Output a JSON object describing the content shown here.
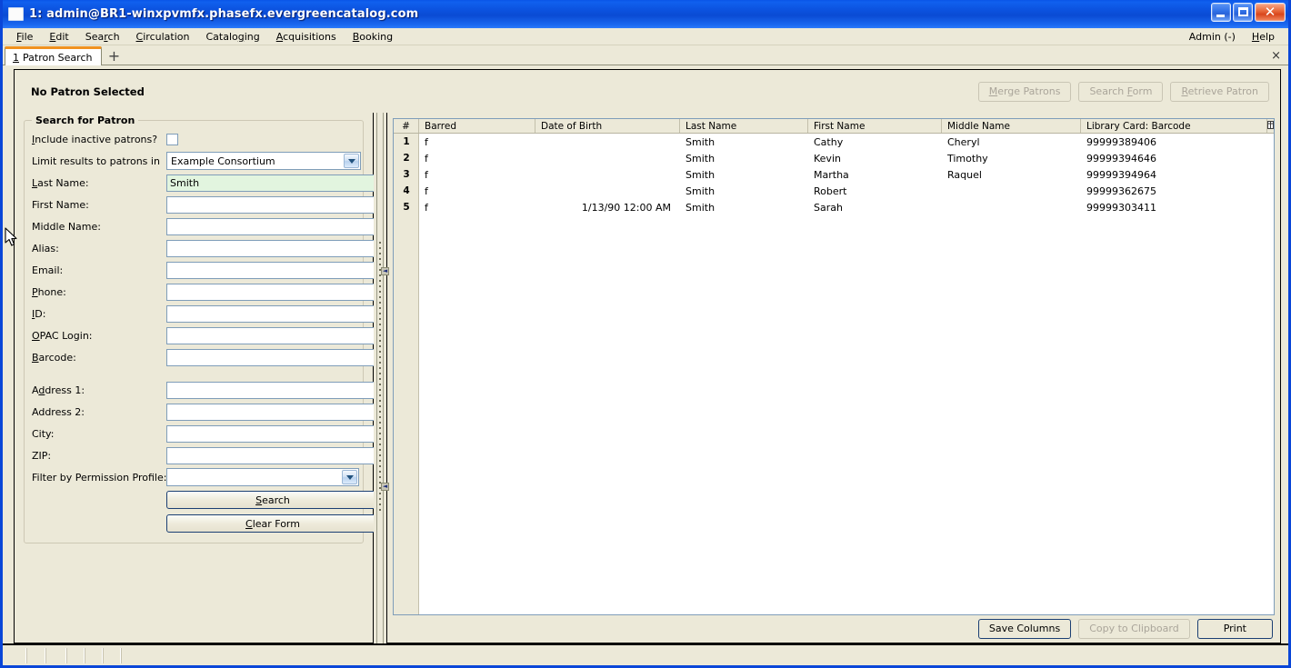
{
  "window": {
    "title": "1: admin@BR1-winxpvmfx.phasefx.evergreencatalog.com",
    "minimize_label": "",
    "maximize_label": "",
    "close_label": "✕"
  },
  "menubar": {
    "items": [
      {
        "label": "File",
        "accel": "F"
      },
      {
        "label": "Edit",
        "accel": "E"
      },
      {
        "label": "Search",
        "accel": "r"
      },
      {
        "label": "Circulation",
        "accel": "C"
      },
      {
        "label": "Cataloging",
        "accel": "g"
      },
      {
        "label": "Acquisitions",
        "accel": "A"
      },
      {
        "label": "Booking",
        "accel": "B"
      }
    ],
    "right_items": [
      {
        "label": "Admin (-)",
        "accel": ""
      },
      {
        "label": "Help",
        "accel": "H"
      }
    ]
  },
  "tabs": {
    "active": {
      "number": "1",
      "label": "Patron Search"
    },
    "new_tab_label": "+",
    "close_all_label": "×"
  },
  "banner": {
    "title": "No Patron Selected",
    "buttons": [
      {
        "label": "Merge Patrons",
        "enabled": false
      },
      {
        "label": "Search Form",
        "enabled": false
      },
      {
        "label": "Retrieve Patron",
        "enabled": false
      }
    ]
  },
  "search_form": {
    "legend": "Search for Patron",
    "include_inactive_label": "Include inactive patrons?",
    "include_inactive_checked": false,
    "limit_results_label": "Limit results to patrons in",
    "limit_results_value": "Example Consortium",
    "fields": [
      {
        "label": "Last Name:",
        "value": "Smith",
        "placeholder": "",
        "focused": true
      },
      {
        "label": "First Name:",
        "value": "",
        "placeholder": "",
        "focused": false
      },
      {
        "label": "Middle Name:",
        "value": "",
        "placeholder": "",
        "focused": false
      },
      {
        "label": "Alias:",
        "value": "",
        "placeholder": "",
        "focused": false
      },
      {
        "label": "Email:",
        "value": "",
        "placeholder": "",
        "focused": false
      },
      {
        "label": "Phone:",
        "value": "",
        "placeholder": "",
        "focused": false
      },
      {
        "label": "ID:",
        "value": "",
        "placeholder": "",
        "focused": false
      },
      {
        "label": "OPAC Login:",
        "value": "",
        "placeholder": "",
        "focused": false
      },
      {
        "label": "Barcode:",
        "value": "",
        "placeholder": "",
        "focused": false
      }
    ],
    "address_fields": [
      {
        "label": "Address 1:",
        "value": "",
        "placeholder": ""
      },
      {
        "label": "Address 2:",
        "value": "",
        "placeholder": ""
      },
      {
        "label": "City:",
        "value": "",
        "placeholder": ""
      },
      {
        "label": "ZIP:",
        "value": "",
        "placeholder": ""
      }
    ],
    "permission_profile_label": "Filter by Permission Profile:",
    "permission_profile_value": "",
    "search_button": "Search",
    "clear_button": "Clear Form"
  },
  "results": {
    "columns": [
      "#",
      "Barred",
      "Date of Birth",
      "Last Name",
      "First Name",
      "Middle Name",
      "Library Card: Barcode"
    ],
    "column_picker_icon": "grid-columns-icon",
    "rows": [
      {
        "num": "1",
        "barred": "f",
        "dob": "",
        "last": "Smith",
        "first": "Cathy",
        "middle": "Cheryl",
        "barcode": "99999389406"
      },
      {
        "num": "2",
        "barred": "f",
        "dob": "",
        "last": "Smith",
        "first": "Kevin",
        "middle": "Timothy",
        "barcode": "99999394646"
      },
      {
        "num": "3",
        "barred": "f",
        "dob": "",
        "last": "Smith",
        "first": "Martha",
        "middle": "Raquel",
        "barcode": "99999394964"
      },
      {
        "num": "4",
        "barred": "f",
        "dob": "",
        "last": "Smith",
        "first": "Robert",
        "middle": "",
        "barcode": "99999362675"
      },
      {
        "num": "5",
        "barred": "f",
        "dob": "1/13/90 12:00 AM",
        "last": "Smith",
        "first": "Sarah",
        "middle": "",
        "barcode": "99999303411"
      }
    ],
    "footer_buttons": [
      {
        "label": "Save Columns",
        "enabled": true,
        "default": true
      },
      {
        "label": "Copy to Clipboard",
        "enabled": false,
        "default": false
      },
      {
        "label": "Print",
        "enabled": true,
        "default": true
      }
    ]
  },
  "colors": {
    "titlebar_blue": "#0a46d8",
    "window_beige": "#ece9d8",
    "tab_accent_orange": "#f0921f",
    "field_focus_green": "#e2f5df",
    "field_border_blue": "#7f9db9"
  }
}
